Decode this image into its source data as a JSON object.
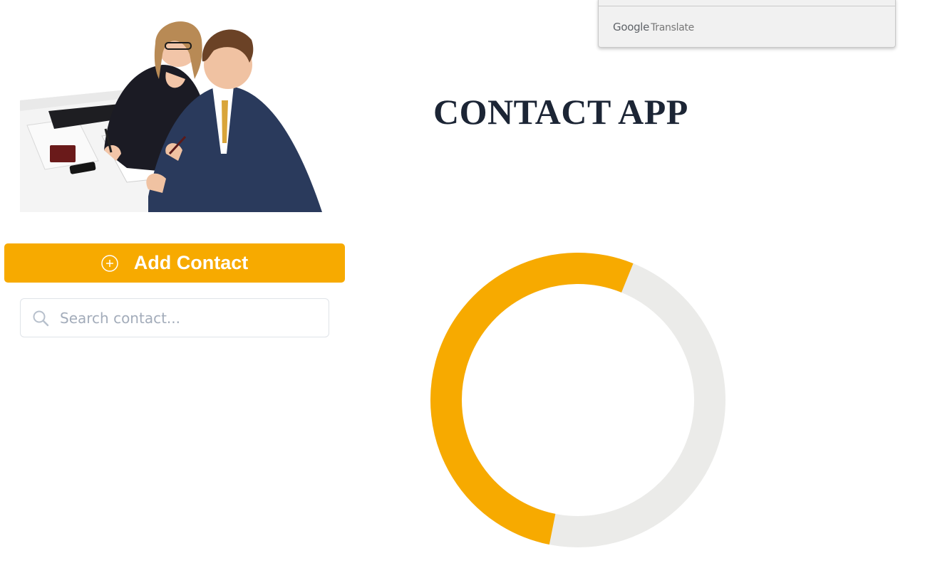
{
  "translate": {
    "brand_google": "Google",
    "brand_translate": "Translate"
  },
  "header": {
    "title": "CONTACT APP"
  },
  "actions": {
    "add_contact_label": "Add Contact",
    "add_icon": "plus-circle-icon"
  },
  "search": {
    "placeholder": "Search contact...",
    "value": "",
    "icon": "search-icon"
  },
  "chart_data": {
    "type": "pie",
    "values": [
      0.53,
      0.47
    ],
    "colors": [
      "#f7aa00",
      "#ebebe9"
    ]
  },
  "colors": {
    "accent": "#f7aa00",
    "ring_background": "#ebebe9",
    "title": "#1c2535"
  }
}
